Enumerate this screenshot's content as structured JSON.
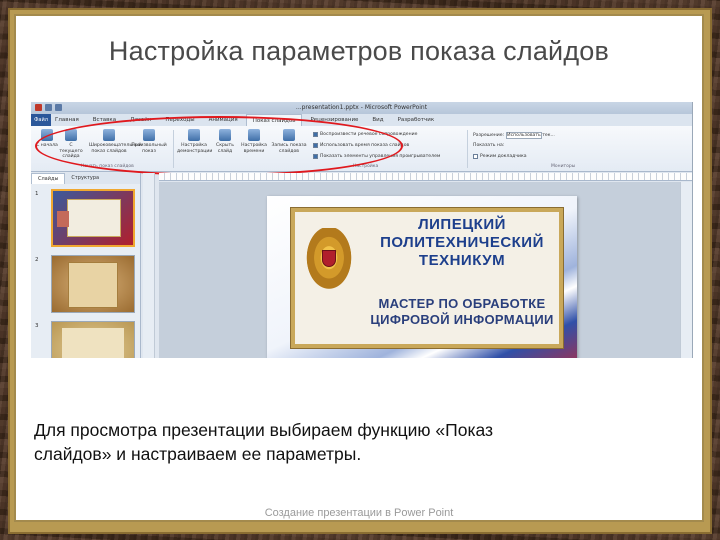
{
  "slide": {
    "title": "Настройка параметров показа слайдов",
    "caption": "Для просмотра презентации выбираем функцию «Показ слайдов» и настраиваем ее параметры.",
    "footer": "Создание презентации в Power Point"
  },
  "app": {
    "window_title": "...presentation1.pptx - Microsoft PowerPoint",
    "file_tab": "Файл",
    "tabs": [
      "Главная",
      "Вставка",
      "Дизайн",
      "Переходы",
      "Анимация",
      "Показ слайдов",
      "Рецензирование",
      "Вид",
      "Разработчик"
    ],
    "active_tab": "Показ слайдов",
    "ribbon": {
      "buttons": [
        {
          "label": "С начала",
          "icon": "play-from-start-icon"
        },
        {
          "label": "С текущего слайда",
          "icon": "play-current-icon"
        },
        {
          "label": "Широковещательный показ слайдов",
          "icon": "broadcast-icon"
        },
        {
          "label": "Произвольный показ",
          "icon": "custom-show-icon"
        },
        {
          "label": "Настройка демонстрации",
          "icon": "setup-show-icon"
        },
        {
          "label": "Скрыть слайд",
          "icon": "hide-slide-icon"
        },
        {
          "label": "Настройка времени",
          "icon": "rehearse-timings-icon"
        },
        {
          "label": "Запись показа слайдов",
          "icon": "record-show-icon"
        }
      ],
      "group_start": "Начать показ слайдов",
      "group_setup": "Настройка",
      "group_monitors": "Мониторы",
      "checkboxes": [
        {
          "label": "Воспроизвести речевое сопровождение",
          "checked": true
        },
        {
          "label": "Использовать время показа слайдов",
          "checked": true
        },
        {
          "label": "Показать элементы управления проигрывателем",
          "checked": true
        }
      ],
      "resolution_label": "Разрешение:",
      "resolution_value": "Использовать тек...",
      "show_on_label": "Показать на:",
      "presenter_view": "Режим докладчика"
    },
    "panel_tabs": [
      "Слайды",
      "Структура"
    ],
    "thumbnails": [
      "1",
      "2",
      "3"
    ],
    "main_slide": {
      "title": "ЛИПЕЦКИЙ ПОЛИТЕХНИЧЕСКИЙ ТЕХНИКУМ",
      "subtitle": "МАСТЕР ПО ОБРАБОТКЕ ЦИФРОВОЙ ИНФОРМАЦИИ"
    }
  },
  "colors": {
    "frame_gold": "#b89a52",
    "highlight_red": "#e0191e",
    "slide_blue": "#1d3f8c",
    "slide_red": "#b11f2c"
  }
}
